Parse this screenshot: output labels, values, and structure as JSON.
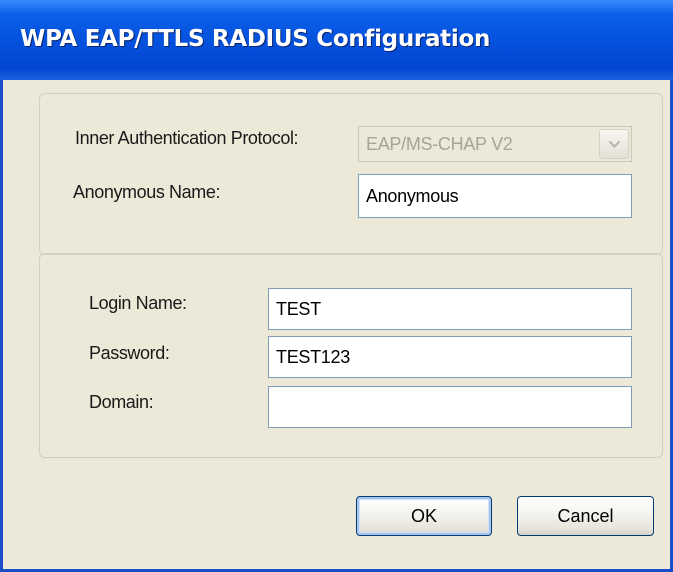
{
  "window": {
    "title": "WPA EAP/TTLS RADIUS Configuration"
  },
  "inner_protocol": {
    "label": "Inner Authentication Protocol:",
    "value": "EAP/MS-CHAP V2",
    "disabled": true
  },
  "anonymous_name": {
    "label": "Anonymous Name:",
    "value": "Anonymous"
  },
  "login_name": {
    "label": "Login Name:",
    "value": "TEST"
  },
  "password": {
    "label": "Password:",
    "value": "TEST123"
  },
  "domain": {
    "label": "Domain:",
    "value": ""
  },
  "buttons": {
    "ok_label": "OK",
    "cancel_label": "Cancel"
  },
  "colors": {
    "titlebar": "#0450dc",
    "dialog_background": "#ece9d8",
    "field_border": "#7f9db9",
    "button_border": "#003c74"
  }
}
